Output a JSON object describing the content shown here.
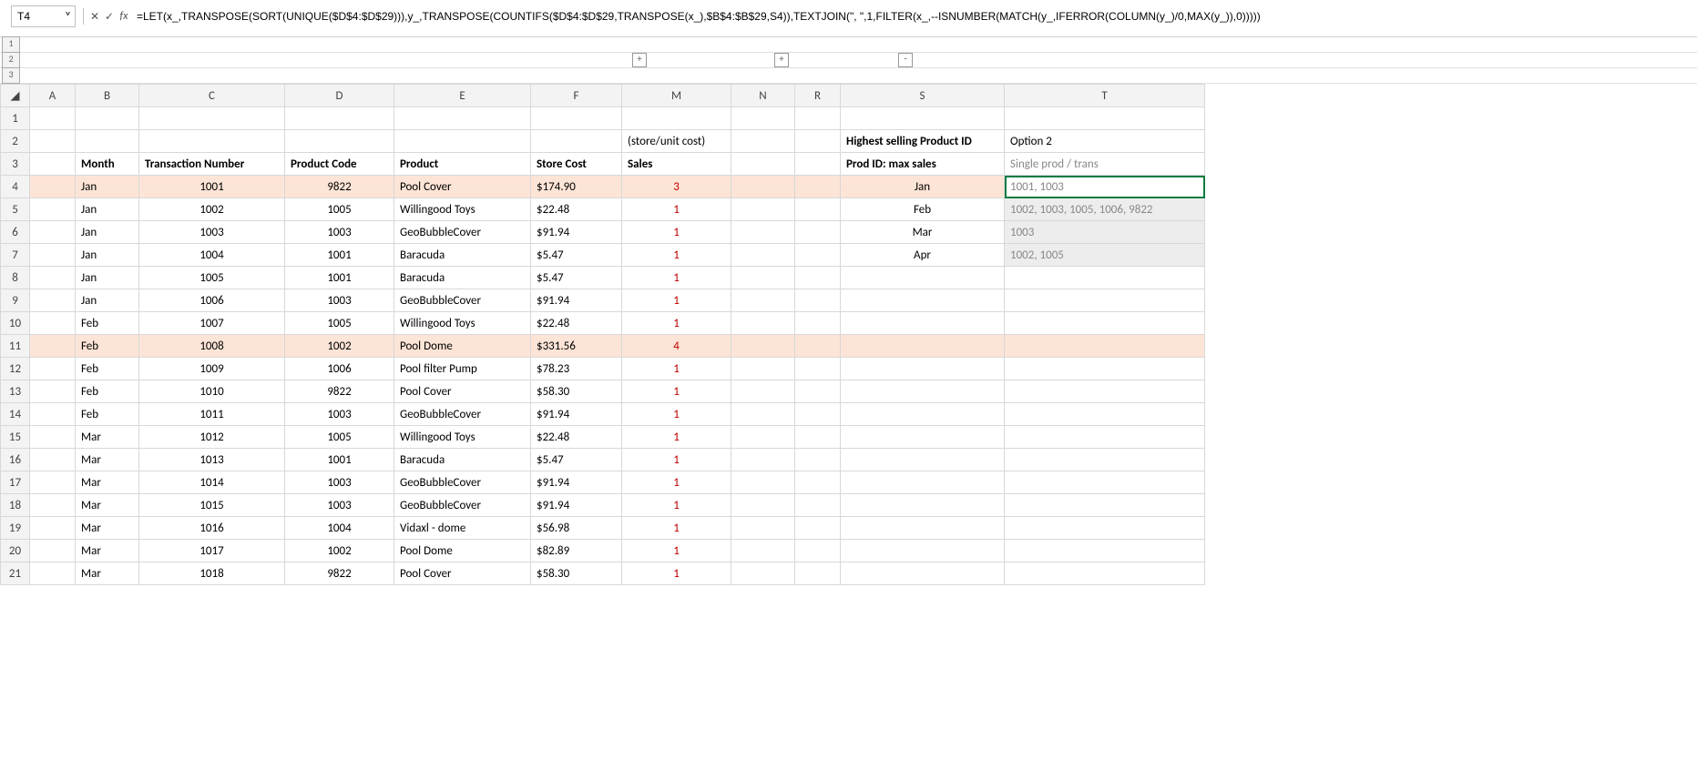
{
  "name_box": {
    "value": "T4"
  },
  "fb_icons": {
    "dropdown": "˅",
    "sep": ":",
    "cancel": "✕",
    "accept": "✓",
    "fx": "fx"
  },
  "formula": "=LET(x_,TRANSPOSE(SORT(UNIQUE($D$4:$D$29))),y_,TRANSPOSE(COUNTIFS($D$4:$D$29,TRANSPOSE(x_),$B$4:$B$29,S4)),TEXTJOIN(\", \",1,FILTER(x_,--ISNUMBER(MATCH(y_,IFERROR(COLUMN(y_)/0,MAX(y_)),0)))))",
  "outline_levels": [
    "1",
    "2",
    "3"
  ],
  "outline_plus": "+",
  "outline_minus": "-",
  "columns": [
    "",
    "A",
    "B",
    "C",
    "D",
    "E",
    "F",
    "M",
    "N",
    "R",
    "S",
    "T"
  ],
  "header2": {
    "M": "(store/unit cost)",
    "S": "Highest selling Product ID",
    "T": "Option 2"
  },
  "header3": {
    "B": "Month",
    "C": "Transaction Number",
    "D": "Product Code",
    "E": "Product",
    "F": "Store Cost",
    "M": "Sales",
    "S": "Prod ID: max sales",
    "T": "Single prod / trans"
  },
  "summary": [
    {
      "month": "Jan",
      "result": "1001, 1003"
    },
    {
      "month": "Feb",
      "result": "1002, 1003, 1005, 1006, 9822"
    },
    {
      "month": "Mar",
      "result": "1003"
    },
    {
      "month": "Apr",
      "result": "1002, 1005"
    }
  ],
  "rows": [
    {
      "r": 4,
      "hl": true,
      "B": "Jan",
      "C": "1001",
      "D": "9822",
      "E": "Pool Cover",
      "F": "$174.90",
      "M": "3"
    },
    {
      "r": 5,
      "hl": false,
      "B": "Jan",
      "C": "1002",
      "D": "1005",
      "E": "Willingood Toys",
      "F": "$22.48",
      "M": "1"
    },
    {
      "r": 6,
      "hl": false,
      "B": "Jan",
      "C": "1003",
      "D": "1003",
      "E": "GeoBubbleCover",
      "F": "$91.94",
      "M": "1"
    },
    {
      "r": 7,
      "hl": false,
      "B": "Jan",
      "C": "1004",
      "D": "1001",
      "E": "Baracuda",
      "F": "$5.47",
      "M": "1"
    },
    {
      "r": 8,
      "hl": false,
      "B": "Jan",
      "C": "1005",
      "D": "1001",
      "E": "Baracuda",
      "F": "$5.47",
      "M": "1"
    },
    {
      "r": 9,
      "hl": false,
      "B": "Jan",
      "C": "1006",
      "D": "1003",
      "E": "GeoBubbleCover",
      "F": "$91.94",
      "M": "1"
    },
    {
      "r": 10,
      "hl": false,
      "B": "Feb",
      "C": "1007",
      "D": "1005",
      "E": "Willingood Toys",
      "F": "$22.48",
      "M": "1"
    },
    {
      "r": 11,
      "hl": true,
      "B": "Feb",
      "C": "1008",
      "D": "1002",
      "E": "Pool Dome",
      "F": "$331.56",
      "M": "4"
    },
    {
      "r": 12,
      "hl": false,
      "B": "Feb",
      "C": "1009",
      "D": "1006",
      "E": "Pool filter Pump",
      "F": "$78.23",
      "M": "1"
    },
    {
      "r": 13,
      "hl": false,
      "B": "Feb",
      "C": "1010",
      "D": "9822",
      "E": "Pool Cover",
      "F": "$58.30",
      "M": "1"
    },
    {
      "r": 14,
      "hl": false,
      "B": "Feb",
      "C": "1011",
      "D": "1003",
      "E": "GeoBubbleCover",
      "F": "$91.94",
      "M": "1"
    },
    {
      "r": 15,
      "hl": false,
      "B": "Mar",
      "C": "1012",
      "D": "1005",
      "E": "Willingood Toys",
      "F": "$22.48",
      "M": "1"
    },
    {
      "r": 16,
      "hl": false,
      "B": "Mar",
      "C": "1013",
      "D": "1001",
      "E": "Baracuda",
      "F": "$5.47",
      "M": "1"
    },
    {
      "r": 17,
      "hl": false,
      "B": "Mar",
      "C": "1014",
      "D": "1003",
      "E": "GeoBubbleCover",
      "F": "$91.94",
      "M": "1"
    },
    {
      "r": 18,
      "hl": false,
      "B": "Mar",
      "C": "1015",
      "D": "1003",
      "E": "GeoBubbleCover",
      "F": "$91.94",
      "M": "1"
    },
    {
      "r": 19,
      "hl": false,
      "B": "Mar",
      "C": "1016",
      "D": "1004",
      "E": "Vidaxl - dome",
      "F": "$56.98",
      "M": "1"
    },
    {
      "r": 20,
      "hl": false,
      "B": "Mar",
      "C": "1017",
      "D": "1002",
      "E": "Pool Dome",
      "F": "$82.89",
      "M": "1"
    },
    {
      "r": 21,
      "hl": false,
      "B": "Mar",
      "C": "1018",
      "D": "9822",
      "E": "Pool Cover",
      "F": "$58.30",
      "M": "1"
    }
  ]
}
